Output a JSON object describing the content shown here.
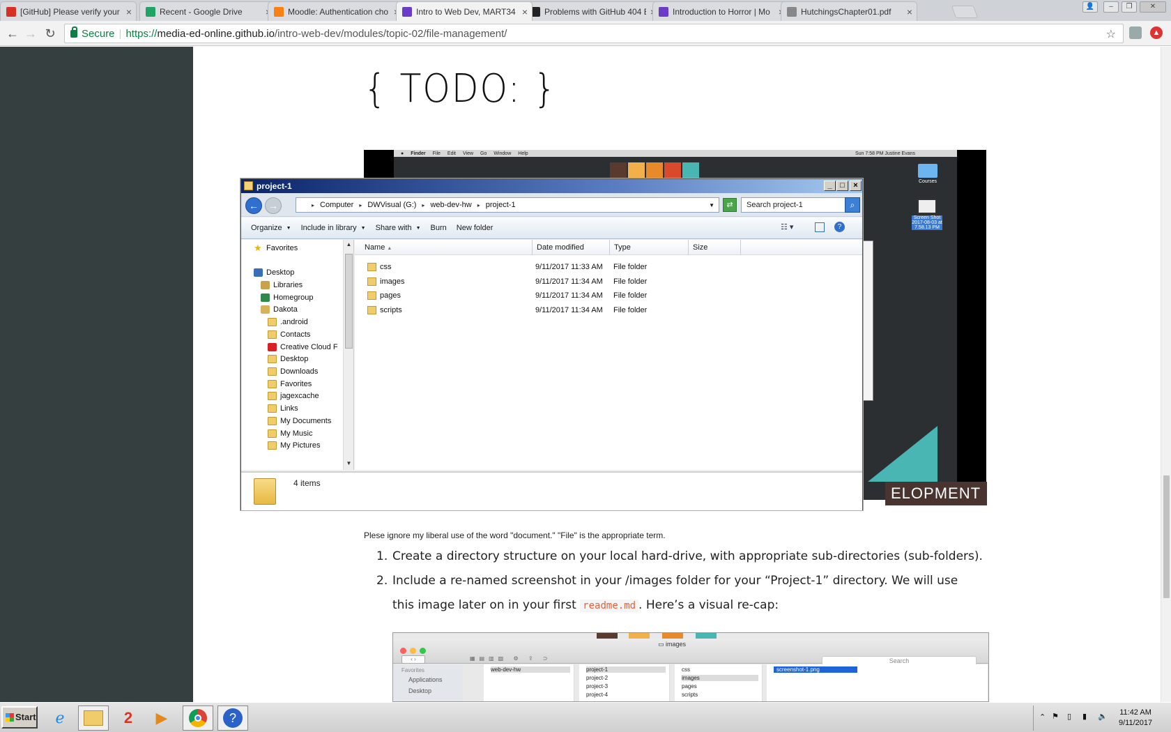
{
  "browser": {
    "tabs": [
      {
        "title": "[GitHub] Please verify your",
        "icon": "gmail-icon"
      },
      {
        "title": "Recent - Google Drive",
        "icon": "drive-icon"
      },
      {
        "title": "Moodle: Authentication cho",
        "icon": "moodle-icon"
      },
      {
        "title": "Intro to Web Dev, MART34",
        "icon": "site-icon",
        "active": true
      },
      {
        "title": "Problems with GitHub 404 E",
        "icon": "github-icon"
      },
      {
        "title": "Introduction to Horror | Mo",
        "icon": "site-icon"
      },
      {
        "title": "HutchingsChapter01.pdf",
        "icon": "document-icon"
      }
    ],
    "secure_label": "Secure",
    "url_scheme": "https://",
    "url_host": "media-ed-online.github.io",
    "url_path": "/intro-web-dev/modules/topic-02/file-management/"
  },
  "page": {
    "heading": "{ TODO: }",
    "mac_screenshot": {
      "menubar": [
        "Finder",
        "File",
        "Edit",
        "View",
        "Go",
        "Window",
        "Help"
      ],
      "menubar_right": "Sun 7:58 PM   Justine Evans",
      "desktop_icons": [
        "Courses",
        "Screen Shot 2017-08-03 at 7.58.13 PM"
      ],
      "banner": "ELOPMENT"
    },
    "caption": "Plese ignore my liberal use of the word \"document.\" \"File\" is the appropriate term.",
    "steps": [
      {
        "num": "1.",
        "text": "Create a directory structure on your local hard-drive, with appropriate sub-directories (sub-folders)."
      },
      {
        "num": "2.",
        "text_before": "Include a re-named screenshot in your /images folder for your “Project-1” directory. We will use this image later on in your first ",
        "code": "readme.md",
        "text_after": ". Here’s a visual re-cap:"
      }
    ],
    "finder_recap": {
      "title": "images",
      "search_placeholder": "Search",
      "sidebar_heading": "Favorites",
      "sidebar_items": [
        "Applications",
        "Desktop"
      ],
      "col1": [
        "web-dev-hw"
      ],
      "col2": [
        "project-1",
        "project-2",
        "project-3",
        "project-4"
      ],
      "col3": [
        "css",
        "images",
        "pages",
        "scripts"
      ],
      "col4": [
        "screenshot-1.png"
      ]
    }
  },
  "explorer": {
    "title": "project-1",
    "breadcrumb": [
      "Computer",
      "DWVisual (G:)",
      "web-dev-hw",
      "project-1"
    ],
    "search_placeholder": "Search project-1",
    "commands": [
      "Organize",
      "Include in library",
      "Share with",
      "Burn",
      "New folder"
    ],
    "nav_items": [
      {
        "label": "Favorites",
        "icon": "star-icon",
        "indent": 0
      },
      {
        "label": "Desktop",
        "icon": "desktop-icon",
        "indent": 0
      },
      {
        "label": "Libraries",
        "icon": "libraries-icon",
        "indent": 1
      },
      {
        "label": "Homegroup",
        "icon": "homegroup-icon",
        "indent": 1
      },
      {
        "label": "Dakota",
        "icon": "user-folder-icon",
        "indent": 1
      },
      {
        "label": ".android",
        "icon": "folder-icon",
        "indent": 2
      },
      {
        "label": "Contacts",
        "icon": "folder-icon",
        "indent": 2
      },
      {
        "label": "Creative Cloud F",
        "icon": "creative-cloud-icon",
        "indent": 2
      },
      {
        "label": "Desktop",
        "icon": "folder-icon",
        "indent": 2
      },
      {
        "label": "Downloads",
        "icon": "folder-icon",
        "indent": 2
      },
      {
        "label": "Favorites",
        "icon": "folder-icon",
        "indent": 2
      },
      {
        "label": "jagexcache",
        "icon": "folder-icon",
        "indent": 2
      },
      {
        "label": "Links",
        "icon": "folder-icon",
        "indent": 2
      },
      {
        "label": "My Documents",
        "icon": "folder-icon",
        "indent": 2
      },
      {
        "label": "My Music",
        "icon": "folder-icon",
        "indent": 2
      },
      {
        "label": "My Pictures",
        "icon": "folder-icon",
        "indent": 2
      }
    ],
    "columns": [
      "Name",
      "Date modified",
      "Type",
      "Size"
    ],
    "files": [
      {
        "name": "css",
        "modified": "9/11/2017 11:33 AM",
        "type": "File folder",
        "size": ""
      },
      {
        "name": "images",
        "modified": "9/11/2017 11:34 AM",
        "type": "File folder",
        "size": ""
      },
      {
        "name": "pages",
        "modified": "9/11/2017 11:34 AM",
        "type": "File folder",
        "size": ""
      },
      {
        "name": "scripts",
        "modified": "9/11/2017 11:34 AM",
        "type": "File folder",
        "size": ""
      }
    ],
    "status": "4 items"
  },
  "taskbar": {
    "start_label": "Start",
    "apps": [
      "internet-explorer-icon",
      "file-explorer-icon",
      "app-2-icon",
      "media-player-icon",
      "chrome-icon",
      "help-icon"
    ],
    "time": "11:42 AM",
    "date": "9/11/2017"
  }
}
